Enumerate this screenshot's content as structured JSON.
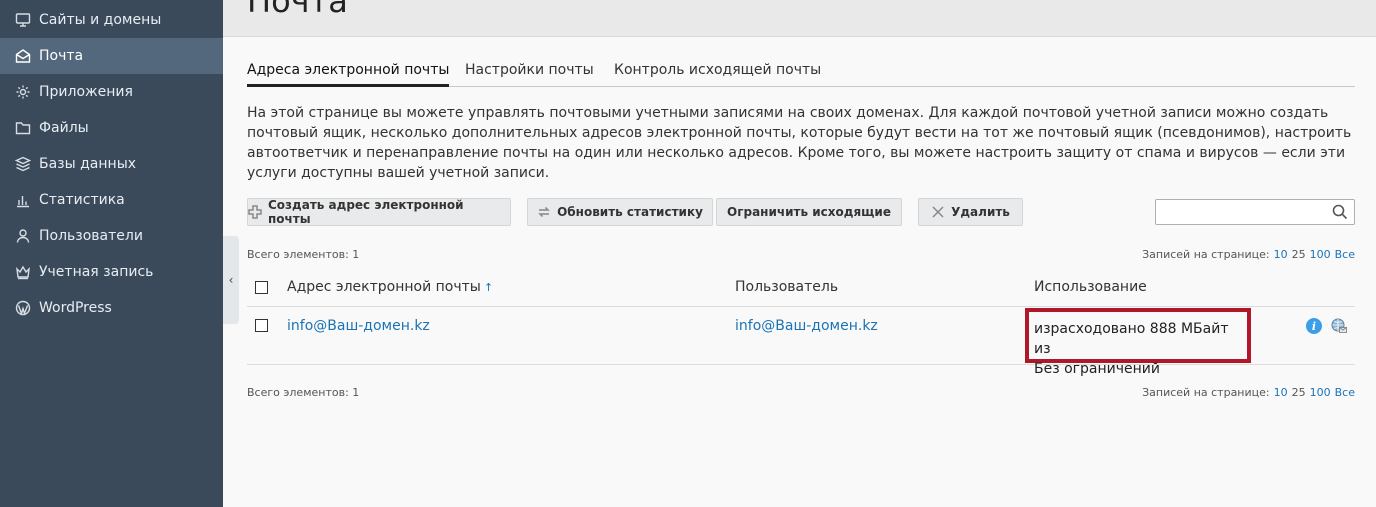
{
  "page": {
    "title": "Почта"
  },
  "sidebar": {
    "items": [
      {
        "label": "Сайты и домены",
        "icon": "monitor-icon",
        "active": false
      },
      {
        "label": "Почта",
        "icon": "mail-icon",
        "active": true
      },
      {
        "label": "Приложения",
        "icon": "gear-icon",
        "active": false
      },
      {
        "label": "Файлы",
        "icon": "folder-icon",
        "active": false
      },
      {
        "label": "Базы данных",
        "icon": "database-icon",
        "active": false
      },
      {
        "label": "Статистика",
        "icon": "bar-chart-icon",
        "active": false
      },
      {
        "label": "Пользователи",
        "icon": "user-icon",
        "active": false
      },
      {
        "label": "Учетная запись",
        "icon": "crown-icon",
        "active": false
      },
      {
        "label": "WordPress",
        "icon": "wordpress-icon",
        "active": false
      }
    ],
    "collapse_glyph": "‹"
  },
  "tabs": [
    {
      "label": "Адреса электронной почты",
      "active": true
    },
    {
      "label": "Настройки почты",
      "active": false
    },
    {
      "label": "Контроль исходящей почты",
      "active": false
    }
  ],
  "description": "На этой странице вы можете управлять почтовыми учетными записями на своих доменах. Для каждой почтовой учетной записи можно создать почтовый ящик, несколько дополнительных адресов электронной почты, которые будут вести на тот же почтовый ящик (псевдонимов), настроить автоответчик и перенаправление почты на один или несколько адресов. Кроме того, вы можете настроить защиту от спама и вирусов — если эти услуги доступны вашей учетной записи.",
  "toolbar": {
    "create_label": "Создать адрес электронной почты",
    "refresh_label": "Обновить статистику",
    "limit_label": "Ограничить исходящие",
    "delete_label": "Удалить",
    "search_placeholder": ""
  },
  "list_info": {
    "total_label": "Всего элементов: 1",
    "per_page_label": "Записей на странице:",
    "per_page_options": [
      "10",
      "25",
      "100",
      "Все"
    ],
    "per_page_selected": "25"
  },
  "table": {
    "columns": [
      "Адрес электронной почты",
      "Пользователь",
      "Использование"
    ],
    "sort_glyph": "↑",
    "rows": [
      {
        "email": "info@Ваш-домен.kz",
        "user": "info@Ваш-домен.kz",
        "usage_line1": "израсходовано 888 МБайт из",
        "usage_line2": "Без ограничений"
      }
    ]
  },
  "colors": {
    "sidebar_bg": "#3a4a5a",
    "sidebar_active": "#53687c",
    "link": "#1a73b5",
    "highlight_border": "#b0182a"
  }
}
